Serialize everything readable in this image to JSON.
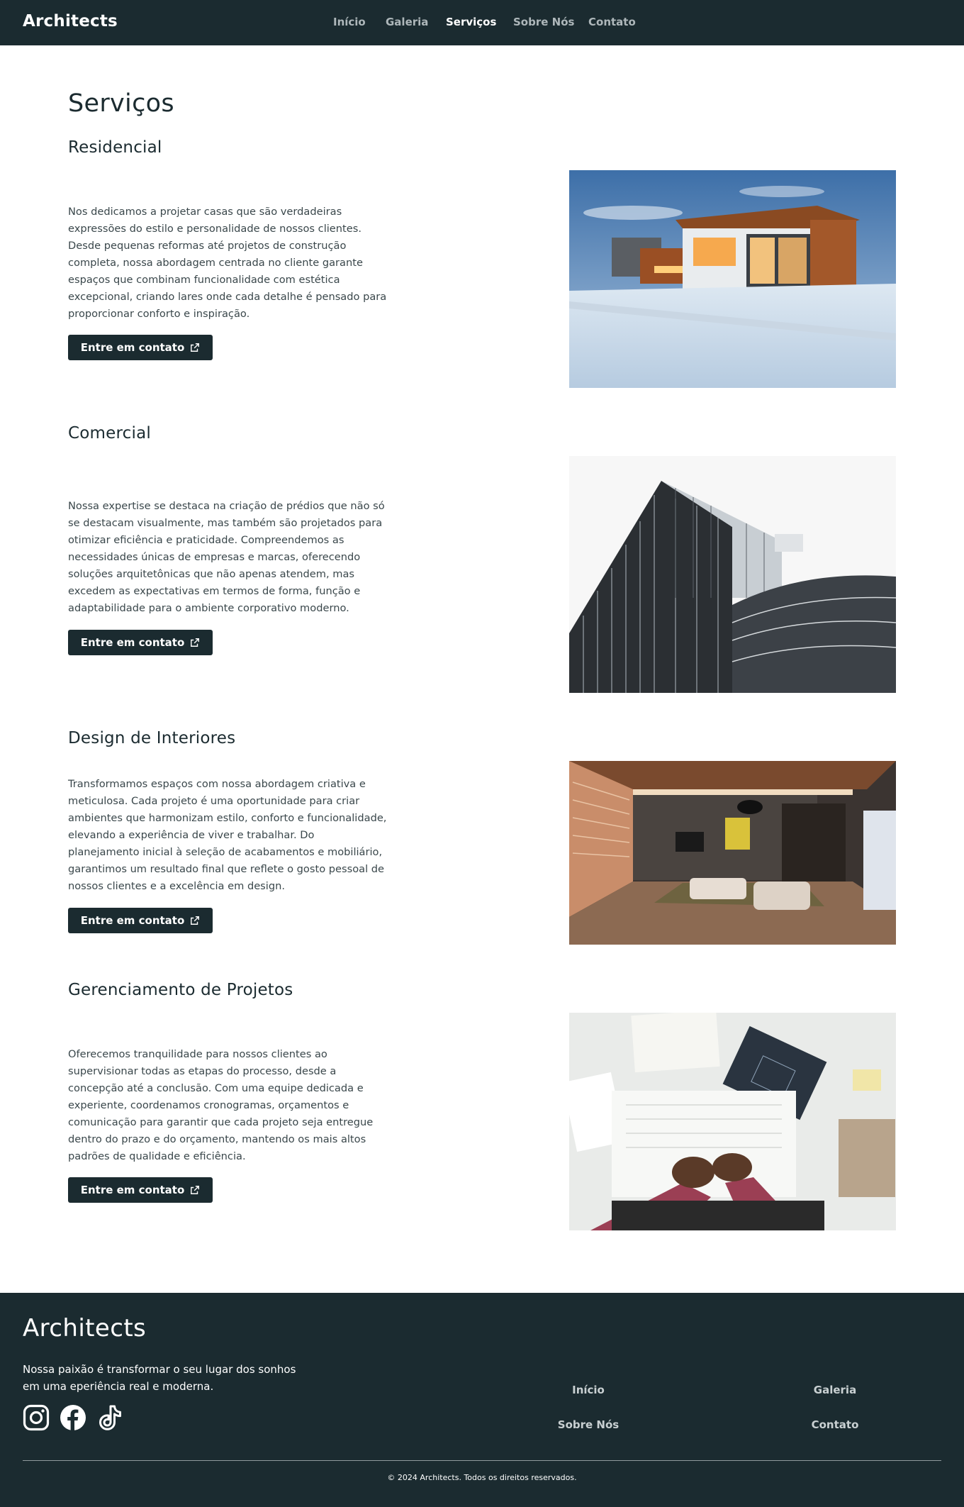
{
  "header": {
    "brand": "Architects",
    "nav": [
      {
        "label": "Início",
        "active": false
      },
      {
        "label": "Galeria",
        "active": false
      },
      {
        "label": "Serviços",
        "active": true
      },
      {
        "label": "Sobre Nós",
        "active": false
      },
      {
        "label": "Contato",
        "active": false
      }
    ]
  },
  "main": {
    "title": "Serviços",
    "services": [
      {
        "title": "Residencial",
        "description": "Nos dedicamos a projetar casas que são verdadeiras expressões do estilo e personalidade de nossos clientes. Desde pequenas reformas até projetos de construção completa, nossa abordagem centrada no cliente garante espaços que combinam funcionalidade com estética excepcional, criando lares onde cada detalhe é pensado para proporcionar conforto e inspiração.",
        "cta": "Entre em contato",
        "image": "modern-house-in-snow"
      },
      {
        "title": "Comercial",
        "description": "Nossa expertise se destaca na criação de prédios que não só se destacam visualmente, mas também são projetados para otimizar eficiência e praticidade. Compreendemos as necessidades únicas de empresas e marcas, oferecendo soluções arquitetônicas que não apenas atendem, mas excedem as expectativas em termos de forma, função e adaptabilidade para o ambiente corporativo moderno.",
        "cta": "Entre em contato",
        "image": "glass-office-building"
      },
      {
        "title": "Design de Interiores",
        "description": "Transformamos espaços com nossa abordagem criativa e meticulosa. Cada projeto é uma oportunidade para criar ambientes que harmonizam estilo, conforto e funcionalidade, elevando a experiência de viver e trabalhar. Do planejamento inicial à seleção de acabamentos e mobiliário, garantimos um resultado final que reflete o gosto pessoal de nossos clientes e a excelência em design.",
        "cta": "Entre em contato",
        "image": "living-room-interior"
      },
      {
        "title": "Gerenciamento de Projetos",
        "description": "Oferecemos tranquilidade para nossos clientes ao supervisionar todas as etapas do processo, desde a concepção até a conclusão. Com uma equipe dedicada e experiente, coordenamos cronogramas, orçamentos e comunicação para garantir que cada projeto seja entregue dentro do prazo e do orçamento, mantendo os mais altos padrões de qualidade e eficiência.",
        "cta": "Entre em contato",
        "image": "architect-drafting-desk"
      }
    ]
  },
  "footer": {
    "brand": "Architects",
    "tagline": "Nossa paixão é transformar o seu lugar dos sonhos em uma eperiência real e moderna.",
    "social": [
      "instagram-icon",
      "facebook-icon",
      "tiktok-icon"
    ],
    "links": [
      "Início",
      "Galeria",
      "Sobre Nós",
      "Contato"
    ],
    "copyright": "© 2024 Architects. Todos os direitos reservados."
  },
  "colors": {
    "primary_dark": "#1b2b30",
    "nav_inactive": "#aeb7ba",
    "body_text": "#3a474b",
    "white": "#ffffff"
  }
}
